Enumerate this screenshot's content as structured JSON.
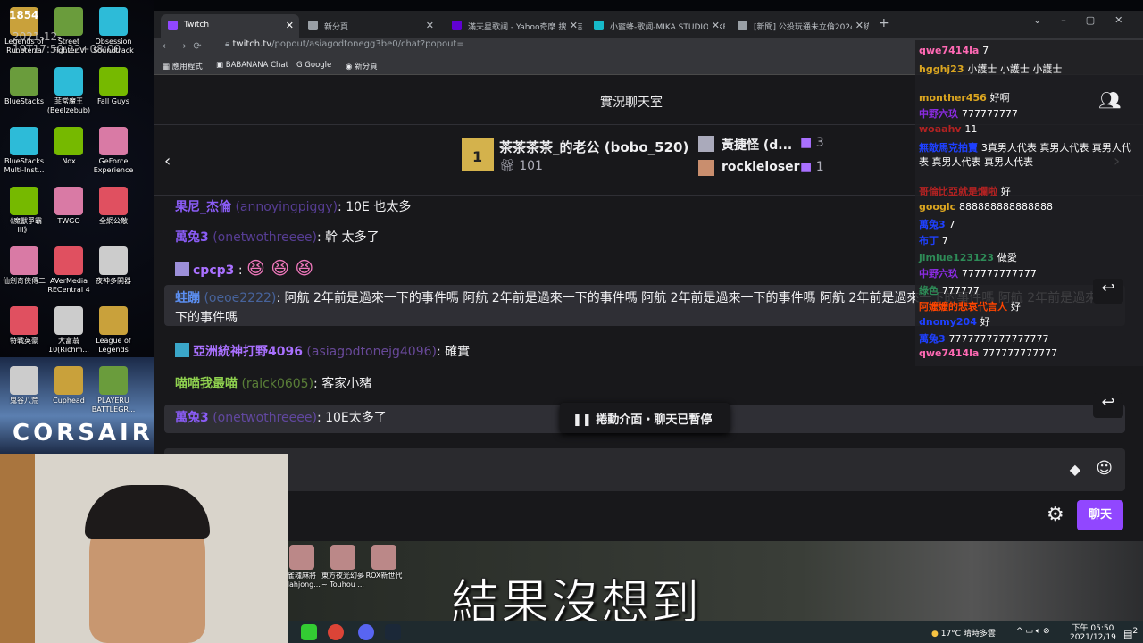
{
  "desktop": {
    "overlay_count": "1854",
    "timestamp": "2021-12-19T17:50:22+08:00",
    "brand": "CORSAIR",
    "icons": [
      [
        "Legends of Runeterra",
        "Street Fighter V",
        "Obsession Soundtrack"
      ],
      [
        "BlueStacks",
        "菲常魔王 (Beelzebub)",
        "Fall Guys"
      ],
      [
        "BlueStacks Multi-Inst...",
        "Nox",
        "GeForce Experience"
      ],
      [
        "《魔獸爭霸III》",
        "TWGO",
        "全網公敵"
      ],
      [
        "仙劍奇俠傳二",
        "AVerMedia RECentral 4",
        "夜神多開器"
      ],
      [
        "特戰英豪",
        "大富翁10(Richm...",
        "League of Legends"
      ],
      [
        "鬼谷八荒",
        "Cuphead",
        "PLAYERU BATTLEGR..."
      ]
    ],
    "bottom_icons": [
      "雀魂麻將 Mahjong...",
      "東方夜光幻夢 ~ Touhou ...",
      "ROX新世代"
    ]
  },
  "browser": {
    "tabs": [
      {
        "label": "Twitch",
        "color": "#9147ff"
      },
      {
        "label": "新分頁",
        "color": "#9aa0a6"
      },
      {
        "label": "滿天星歌詞 - Yahoo奇摩 搜尋結果",
        "color": "#6001d2"
      },
      {
        "label": "小蜜蜂-歌詞-MIKA STUDIO-KKBOX",
        "color": "#16b9c9"
      },
      {
        "label": "[新聞] 公投玩通未立倫2024總統",
        "color": "#9aa0a6"
      }
    ],
    "url_host": "twitch.tv",
    "url_path": "/popout/asiagodtonegg3be0/chat?popout=",
    "bookmarks": [
      "應用程式",
      "BABANANA Chat",
      "Google",
      "新分頁"
    ]
  },
  "chat": {
    "title": "實況聊天室",
    "leaderboard": [
      {
        "rank": "1",
        "name": "茶茶茶茶_的老公 (bobo_520)",
        "count": "101"
      },
      {
        "rank": "2",
        "name": "黃捷怪 (d...",
        "count": "3"
      },
      {
        "rank": "3",
        "name": "rockieloser",
        "count": "1"
      }
    ],
    "messages": [
      {
        "display": "果尼_杰倫",
        "login": "(annoyingpiggy)",
        "text": ": 10E 也太多",
        "color": "#8a5cf6"
      },
      {
        "display": "萬兔3",
        "login": "(onetwothreeee)",
        "text": ": 幹 太多了",
        "color": "#8a5cf6"
      },
      {
        "display": "cpcp3",
        "login": "",
        "text": ":",
        "color": "#a970ff"
      },
      {
        "display": "蛙蹦",
        "login": "(oeoe2222)",
        "text": ": 阿航 2年前是過來一下的事件嗎 阿航 2年前是過來一下的事件嗎 阿航 2年前是過來一下的事件嗎 阿航 2年前是過來一下的事件嗎 阿航 2年前是過來一下的事件嗎",
        "color": "#5b8ef0"
      },
      {
        "display": "亞洲統神打野4096",
        "login": "(asiagodtonejg4096)",
        "text": ": 確實",
        "color": "#a970ff"
      },
      {
        "display": "喵喵我最喵",
        "login": "(raick0605)",
        "text": ": 客家小豬",
        "color": "#8fd14f"
      },
      {
        "display": "萬兔3",
        "login": "(onetwothreeee)",
        "text": ": 10E太多了",
        "color": "#8a5cf6"
      }
    ],
    "paused": "捲動介面・聊天已暫停",
    "send": "聊天"
  },
  "overlay": {
    "messages": [
      {
        "user": "qwe7414la",
        "text": "7",
        "color": "#ff69b4"
      },
      {
        "user": "hgghj23",
        "text": "小護士 小護士 小護士",
        "color": "#daa520"
      },
      {
        "user": "monther456",
        "text": "好啊",
        "color": "#daa520"
      },
      {
        "user": "中野六玖",
        "text": "777777777",
        "color": "#8a2be2"
      },
      {
        "user": "woaahv",
        "text": "11",
        "color": "#b22222"
      },
      {
        "user": "無敵馬克拍賣",
        "text": "3真男人代表 真男人代表 真男人代表 真男人代表 真男人代表",
        "color": "#1e40ff"
      },
      {
        "user": "哥倫比亞就是爛啦",
        "text": "好",
        "color": "#b22222"
      },
      {
        "user": "googlc",
        "text": "888888888888888",
        "color": "#daa520"
      },
      {
        "user": "萬兔3",
        "text": "7",
        "color": "#1e40ff"
      },
      {
        "user": "布丁",
        "text": "7",
        "color": "#1e40ff"
      },
      {
        "user": "jimlue123123",
        "text": "做愛",
        "color": "#2e8b57"
      },
      {
        "user": "中野六玖",
        "text": "777777777777",
        "color": "#8a2be2"
      },
      {
        "user": "綠色",
        "text": "777777",
        "color": "#2e8b57"
      },
      {
        "user": "阿嬤嬤的悲哀代言人",
        "text": "好",
        "color": "#ff4500"
      },
      {
        "user": "dnomy204",
        "text": "好",
        "color": "#1e40ff"
      },
      {
        "user": "萬兔3",
        "text": "7777777777777777",
        "color": "#1e40ff"
      },
      {
        "user": "qwe7414la",
        "text": "777777777777",
        "color": "#ff69b4"
      }
    ]
  },
  "subtitle": "結果沒想到",
  "taskbar": {
    "weather": "17°C 晴時多雲",
    "time": "下午 05:50",
    "date": "2021/12/19",
    "notifications": "2"
  }
}
